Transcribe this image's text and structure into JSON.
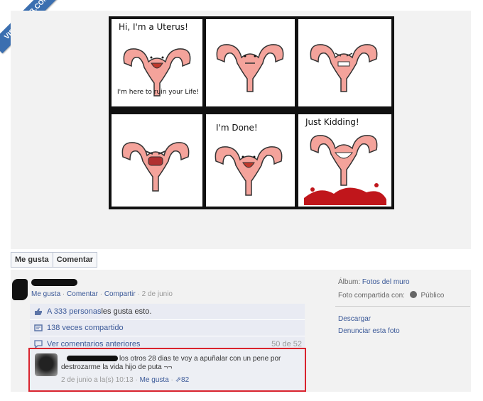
{
  "watermark": "VISTOENFB.COM",
  "comic": {
    "panel1_title": "Hi, I'm a Uterus!",
    "panel1_sub": "I'm here to ruin your Life!",
    "panel5_title": "I'm Done!",
    "panel6_title": "Just Kidding!"
  },
  "actions": {
    "like": "Me gusta",
    "comment": "Comentar"
  },
  "post": {
    "like": "Me gusta",
    "comment": "Comentar",
    "share": "Compartir",
    "date": "2 de junio"
  },
  "feed": {
    "likes_count": "A 333 personas",
    "likes_suffix": " les gusta esto.",
    "shared": "138 veces compartido",
    "prev_comments": "Ver comentarios anteriores",
    "count": "50 de 52"
  },
  "comment": {
    "text": "los otros 28 dias te voy a apuñalar con un pene por destrozarme la vida hijo de puta ¬¬",
    "timestamp": "2 de junio a la(s) 10:13",
    "like": "Me gusta",
    "likes": "82"
  },
  "sidebar": {
    "album_label": "Álbum:",
    "album_value": "Fotos del muro",
    "shared_with_label": "Foto compartida con:",
    "shared_with_value": "Público",
    "download": "Descargar",
    "report": "Denunciar esta foto"
  },
  "colors": {
    "link": "#3b5998",
    "highlight": "#d9232e",
    "uterus": "#f4a39b"
  }
}
